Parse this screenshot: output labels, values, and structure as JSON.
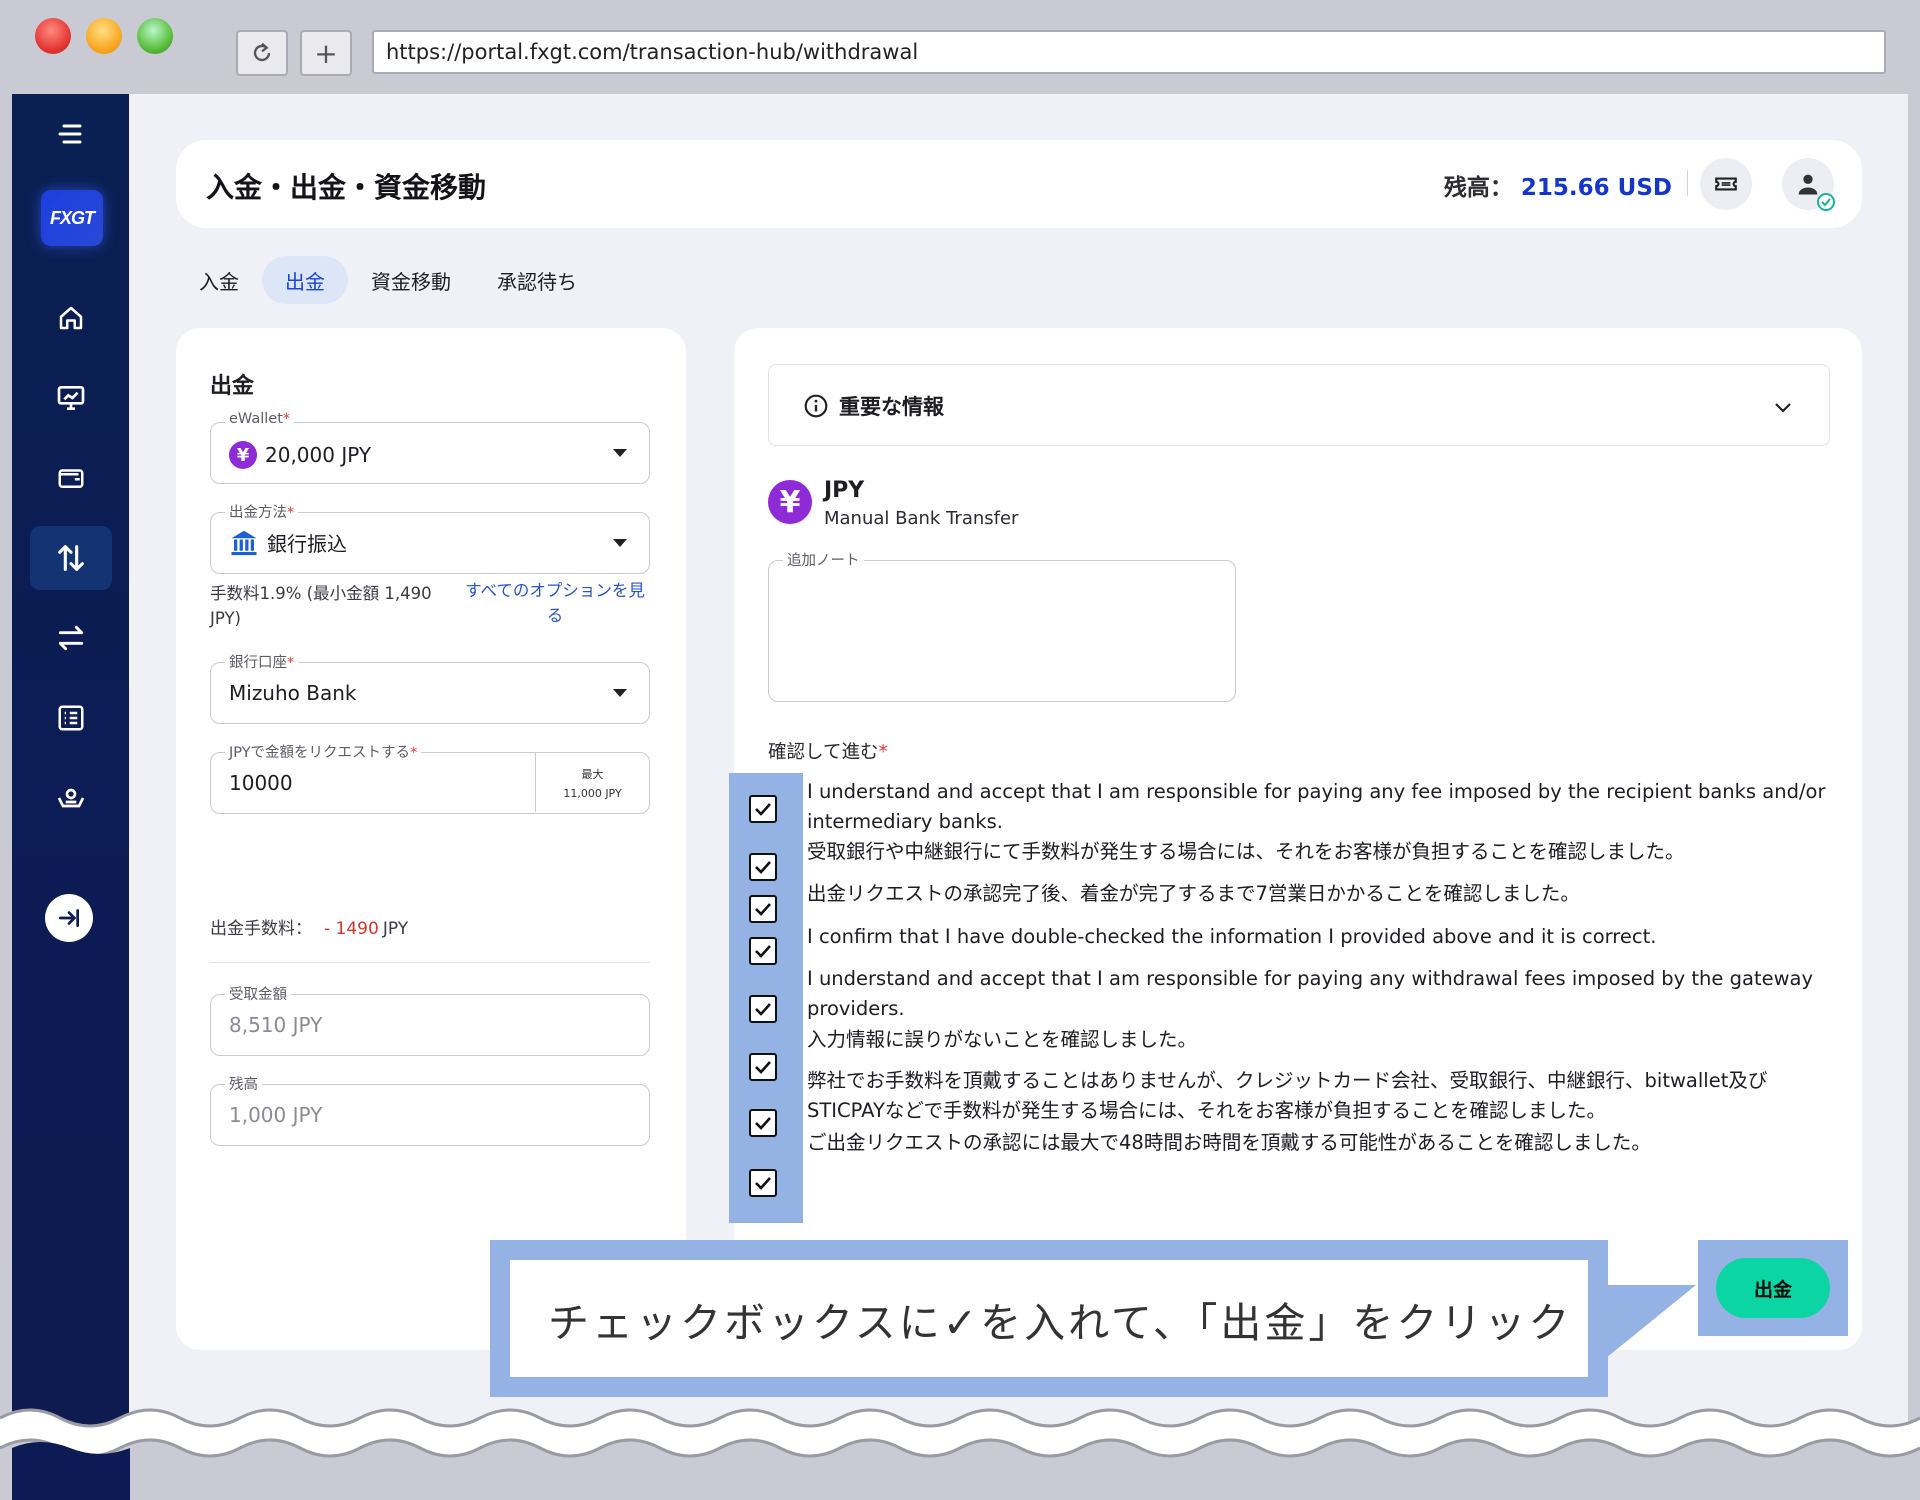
{
  "browser": {
    "url": "https://portal.fxgt.com/transaction-hub/withdrawal"
  },
  "sidebar": {
    "logo": "FXGT",
    "items": [
      {
        "icon": "menu-icon"
      },
      {
        "icon": "home-icon"
      },
      {
        "icon": "chart-monitor-icon"
      },
      {
        "icon": "wallet-icon"
      },
      {
        "icon": "transfer-updown-icon",
        "active": true
      },
      {
        "icon": "exchange-arrows-icon"
      },
      {
        "icon": "list-icon"
      },
      {
        "icon": "hand-coin-icon"
      },
      {
        "icon": "collapse-arrow-icon"
      }
    ]
  },
  "header": {
    "title": "入金・出金・資金移動",
    "balance_label": "残高：",
    "balance_value": "215.66 USD",
    "accent": "#1536c9"
  },
  "tabs": [
    {
      "label": "入金",
      "active": false
    },
    {
      "label": "出金",
      "active": true
    },
    {
      "label": "資金移動",
      "active": false
    },
    {
      "label": "承認待ち",
      "active": false
    }
  ],
  "form": {
    "title": "出金",
    "ewallet": {
      "label": "eWallet",
      "value": "20,000 JPY"
    },
    "method": {
      "label": "出金方法",
      "value": "銀行振込"
    },
    "fee_note": [
      "手数料1.9% (最小金額 1,490",
      "JPY)"
    ],
    "options_link": [
      "すべてのオプションを見",
      "る"
    ],
    "bank": {
      "label": "銀行口座",
      "value": "Mizuho Bank"
    },
    "amount": {
      "label": "JPYで金額をリクエストする",
      "value": "10000",
      "max_label": "最大",
      "max_value": "11,000 JPY"
    },
    "fee_line": {
      "label": "出金手数料：",
      "value": "- 1490",
      "unit": "JPY"
    },
    "received": {
      "label": "受取金額",
      "value": "8,510 JPY"
    },
    "remaining": {
      "label": "残高",
      "value": "1,000 JPY"
    }
  },
  "details": {
    "info_title": "重要な情報",
    "currency_code": "JPY",
    "currency_method": "Manual Bank Transfer",
    "note_label": "追加ノート",
    "confirm_label": "確認して進む",
    "confirmations": [
      "I understand and accept that I am responsible for paying any fee imposed by the recipient banks and/or intermediary banks.",
      "受取銀行や中継銀行にて手数料が発生する場合には、それをお客様が負担することを確認しました。",
      "出金リクエストの承認完了後、着金が完了するまで7営業日かかることを確認しました。",
      "I confirm that I have double-checked the information I provided above and it is correct.",
      "I understand and accept that I am responsible for paying any withdrawal fees imposed by the gateway providers.",
      "入力情報に誤りがないことを確認しました。",
      "弊社でお手数料を頂戴することはありませんが、クレジットカード会社、受取銀行、中継銀行、bitwallet及びSTICPAYなどで手数料が発生する場合には、それをお客様が負担することを確認しました。",
      "ご出金リクエストの承認には最大で48時間お時間を頂戴する可能性があることを確認しました。"
    ],
    "submit_label": "出金"
  },
  "callout": {
    "text": "チェックボックスに✓を入れて、「出金」をクリック"
  }
}
